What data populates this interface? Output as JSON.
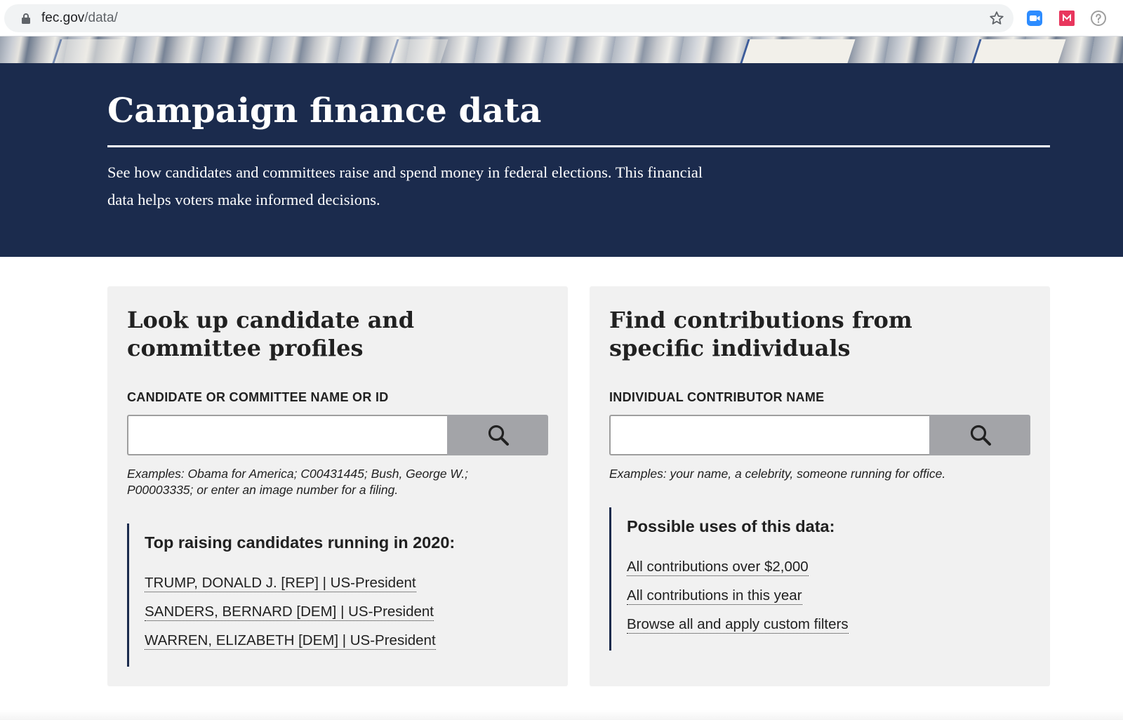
{
  "browser": {
    "url_host": "fec.gov",
    "url_path": "/data/"
  },
  "hero": {
    "title": "Campaign finance data",
    "lede": "See how candidates and committees raise and spend money in federal elections. This financial data helps voters make informed decisions."
  },
  "candidate_card": {
    "title": "Look up candidate and committee profiles",
    "field_label": "CANDIDATE OR COMMITTEE NAME OR ID",
    "input_value": "",
    "examples": "Examples: Obama for America; C00431445; Bush, George W.; P00003335; or enter an image number for a filing.",
    "callout_heading": "Top raising candidates running in 2020:",
    "links": [
      "TRUMP, DONALD J. [REP] | US-President",
      "SANDERS, BERNARD [DEM] | US-President",
      "WARREN, ELIZABETH [DEM] | US-President"
    ]
  },
  "contributions_card": {
    "title": "Find contributions from specific individuals",
    "field_label": "INDIVIDUAL CONTRIBUTOR NAME",
    "input_value": "",
    "examples": "Examples: your name, a celebrity, someone running for office.",
    "callout_heading": "Possible uses of this data:",
    "links": [
      "All contributions over $2,000",
      "All contributions in this year",
      "Browse all and apply custom filters"
    ]
  },
  "colors": {
    "hero_background": "#1b2b4d",
    "card_background": "#f1f1f1",
    "search_button": "#a3a4a8",
    "extension_zoom": "#2d8cff",
    "extension_m": "#e8365d"
  },
  "icons": {
    "address_bar": [
      "lock-icon",
      "star-icon"
    ],
    "extensions": [
      "zoom-extension-icon",
      "m-extension-icon",
      "help-extension-icon"
    ],
    "search": "search-icon"
  }
}
